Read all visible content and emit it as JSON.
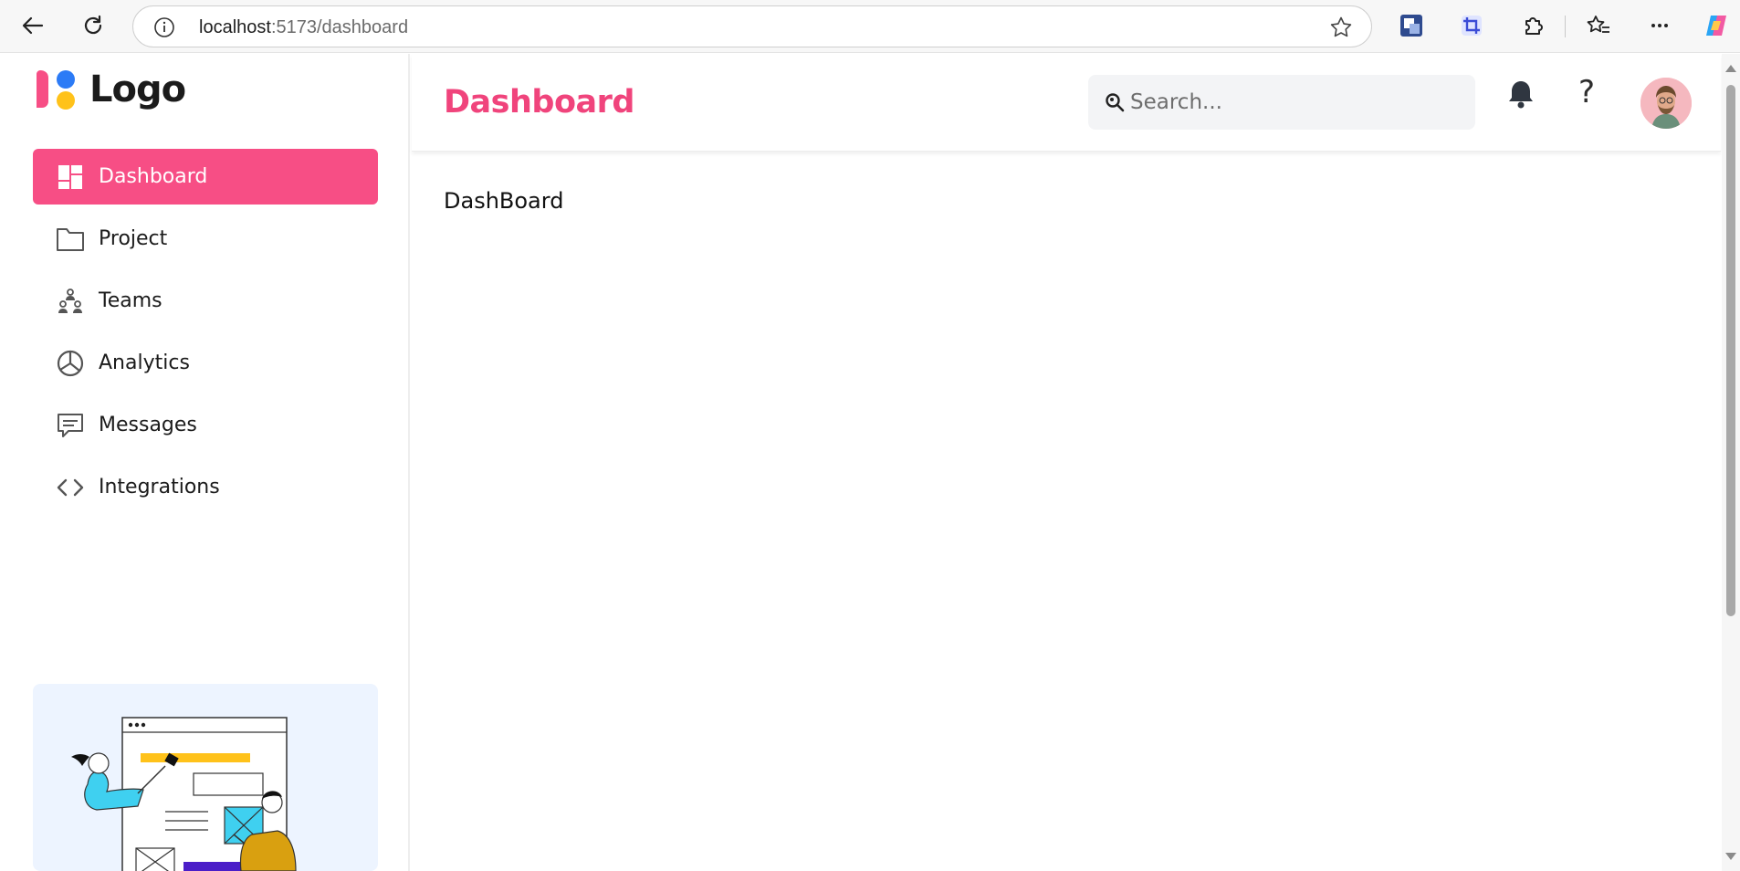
{
  "browser": {
    "url_host": "localhost",
    "url_path": ":5173/dashboard",
    "icons": [
      "back-arrow-icon",
      "refresh-icon",
      "site-info-icon",
      "favorite-star-icon",
      "translate-extension-icon",
      "crop-extension-icon",
      "extensions-puzzle-icon",
      "favorites-icon",
      "more-menu-icon",
      "copilot-icon"
    ]
  },
  "sidebar": {
    "logo_text": "Logo",
    "items": [
      {
        "label": "Dashboard",
        "icon": "dashboard-icon",
        "active": true
      },
      {
        "label": "Project",
        "icon": "folder-icon",
        "active": false
      },
      {
        "label": "Teams",
        "icon": "teams-icon",
        "active": false
      },
      {
        "label": "Analytics",
        "icon": "pie-chart-icon",
        "active": false
      },
      {
        "label": "Messages",
        "icon": "message-icon",
        "active": false
      },
      {
        "label": "Integrations",
        "icon": "code-icon",
        "active": false
      }
    ]
  },
  "header": {
    "title": "Dashboard",
    "search_placeholder": "Search...",
    "help_label": "?"
  },
  "main": {
    "content_text": "DashBoard"
  },
  "colors": {
    "accent": "#f74e85",
    "title": "#f0447c",
    "promo_bg": "#edf4ff"
  }
}
